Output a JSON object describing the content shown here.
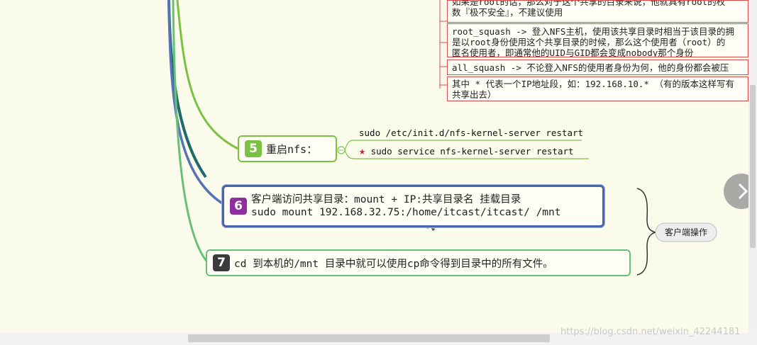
{
  "notes": [
    {
      "lines": [
        "如果是root的话，那么对于这个共享的目录来说，他就具有root的权",
        "数『极不安全』，不建议使用"
      ]
    },
    {
      "lines": [
        "root_squash -> 登入NFS主机，使用该共享目录时相当于该目录的拥",
        "是以root身份使用这个共享目录的时候，那么这个使用者（root）的",
        "匿名使用者，即通常他的UID与GID都会变成nobody那个身份"
      ]
    },
    {
      "lines": [
        "all_squash -> 不论登入NFS的使用者身份为何，他的身份都会被压"
      ]
    },
    {
      "lines": [
        "其中 * 代表一个IP地址段，如：192.168.10.* （有的版本这样写有",
        "共享出去）"
      ]
    }
  ],
  "topic5": {
    "num": "5",
    "label": "重启nfs：",
    "color": "#7cc242"
  },
  "topic5_leaves": [
    "sudo /etc/init.d/nfs-kernel-server restart",
    "sudo service nfs-kernel-server restart"
  ],
  "topic6": {
    "num": "6",
    "line1": "客户端访问共享目录：mount + IP:共享目录名 挂载目录",
    "line2": "sudo mount 192.168.32.75:/home/itcast/itcast/ /mnt",
    "color": "#8e2ea0"
  },
  "topic7": {
    "num": "7",
    "label": "cd 到本机的/mnt 目录中就可以使用cp命令得到目录中的所有文件。",
    "color": "#3b3b3b"
  },
  "summary_label": "客户端操作",
  "watermark": "https://blog.csdn.net/weixin_42244181",
  "colors": {
    "branch5": "#7cc242",
    "branch6": "#5472b8",
    "branch7": "#66c078",
    "branch_dark": "#1f6a6a"
  }
}
